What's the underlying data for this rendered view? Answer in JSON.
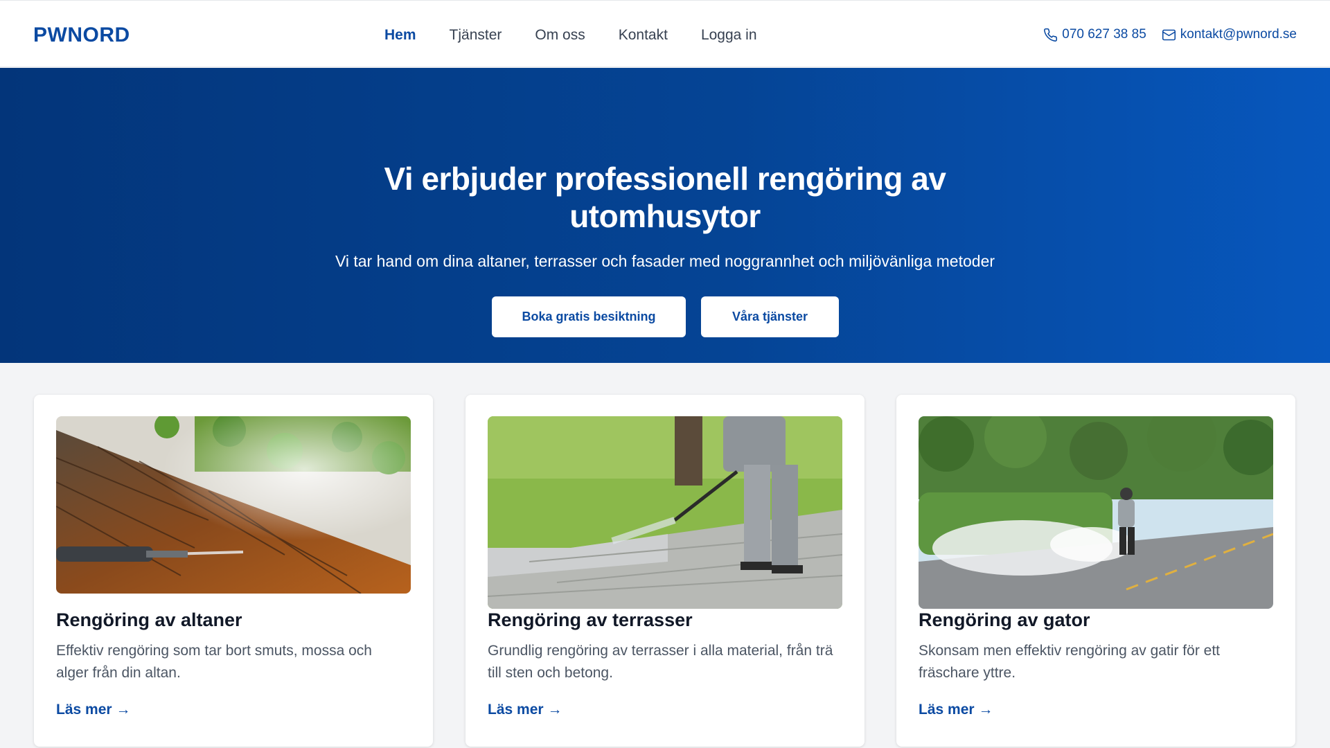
{
  "header": {
    "logo": "PWNORD",
    "nav": [
      "Hem",
      "Tjänster",
      "Om oss",
      "Kontakt",
      "Logga in"
    ],
    "phone": "070 627 38 85",
    "email": "kontakt@pwnord.se",
    "phone_icon": "phone-icon",
    "email_icon": "mail-icon"
  },
  "hero": {
    "title": "Vi erbjuder professionell rengöring av utomhusytor",
    "subtitle": "Vi tar hand om dina altaner, terrasser och fasader med noggrannhet och miljövänliga metoder",
    "primary_button": "Boka gratis besiktning",
    "secondary_button": "Våra tjänster"
  },
  "services": [
    {
      "title": "Rengöring av altaner",
      "description": "Effektiv rengöring som tar bort smuts, mossa och alger från din altan.",
      "link": "Läs mer"
    },
    {
      "title": "Rengöring av terrasser",
      "description": "Grundlig rengöring av terrasser i alla material, från trä till sten och betong.",
      "link": "Läs mer"
    },
    {
      "title": "Rengöring av gator",
      "description": "Skonsam men effektiv rengöring av gatir för ett fräschare yttre.",
      "link": "Läs mer"
    }
  ],
  "colors": {
    "brand": "#0b4aa2",
    "hero_start": "#03357a",
    "hero_end": "#0757bd"
  }
}
